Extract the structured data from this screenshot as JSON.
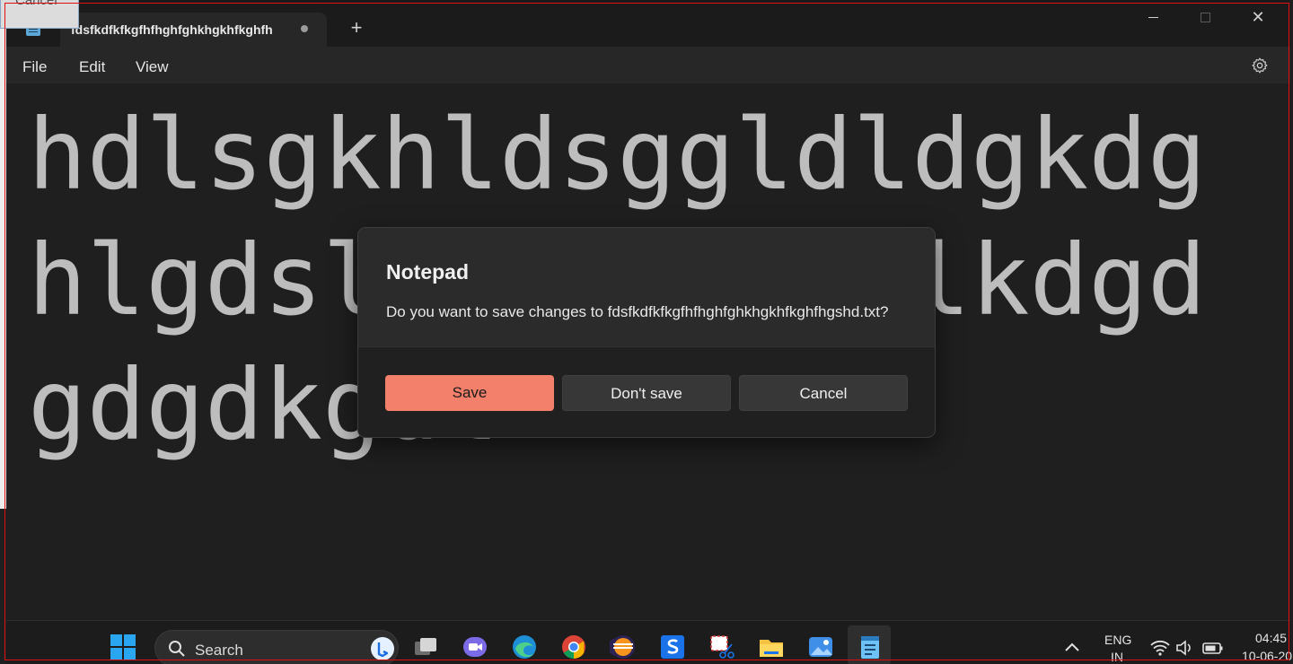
{
  "ghost_window": {
    "cancel_label": "Cancel"
  },
  "window": {
    "tab_title": "fdsfkdfkfkgfhfhghfghkhgkhfkghfh",
    "new_tab_symbol": "+",
    "close_symbol": "✕"
  },
  "menu": {
    "items": [
      "File",
      "Edit",
      "View"
    ]
  },
  "editor": {
    "content": "hdlsgkhldsggldldgkdghlgdslkgklglgkglkdgdgdgdkgdl"
  },
  "dialog": {
    "title": "Notepad",
    "message": "Do you want to save changes to fdsfkdfkfkgfhfhghfghkhgkhfkghfhgshd.txt?",
    "save_label": "Save",
    "dont_save_label": "Don't save",
    "cancel_label": "Cancel",
    "accent_color": "#f2806a"
  },
  "taskbar": {
    "search_label": "Search",
    "apps": [
      "start-icon",
      "search",
      "task-view-icon",
      "teams-icon",
      "edge-icon",
      "chrome-icon",
      "eclipse-icon",
      "s-app-icon",
      "snipping-tool-icon",
      "file-explorer-icon",
      "photos-icon",
      "notepad-icon"
    ],
    "language_top": "ENG",
    "language_bottom": "IN",
    "time": "04:45",
    "date": "10-06-20"
  }
}
